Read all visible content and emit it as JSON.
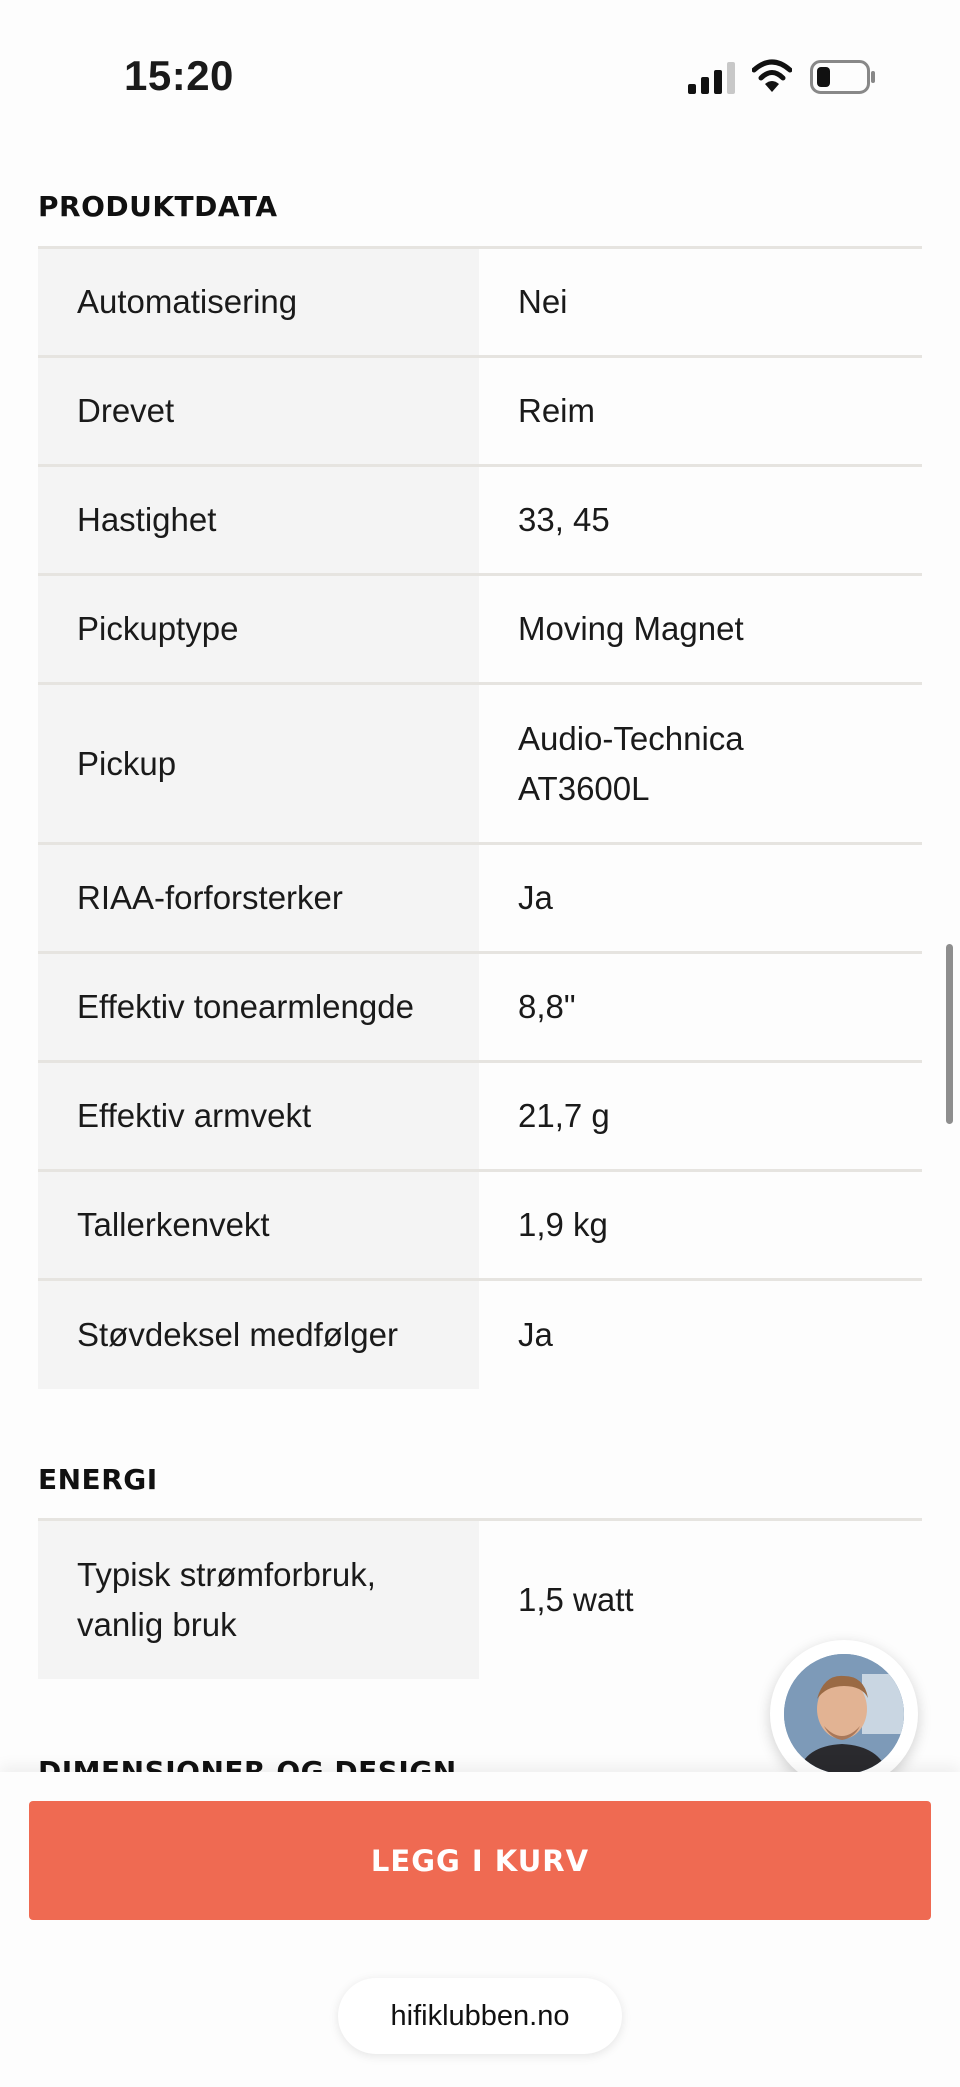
{
  "status_bar": {
    "time": "15:20"
  },
  "sections": {
    "produktdata": {
      "title": "PRODUKTDATA",
      "rows": [
        {
          "label": "Automatisering",
          "value": "Nei"
        },
        {
          "label": "Drevet",
          "value": "Reim"
        },
        {
          "label": "Hastighet",
          "value": "33, 45"
        },
        {
          "label": "Pickuptype",
          "value": "Moving Magnet"
        },
        {
          "label": "Pickup",
          "value": "Audio-Technica AT3600L"
        },
        {
          "label": "RIAA-forforsterker",
          "value": "Ja"
        },
        {
          "label": "Effektiv tonearmlengde",
          "value": "8,8\""
        },
        {
          "label": "Effektiv armvekt",
          "value": "21,7 g"
        },
        {
          "label": "Tallerkenvekt",
          "value": "1,9 kg"
        },
        {
          "label": "Støvdeksel medfølger",
          "value": "Ja"
        }
      ]
    },
    "energi": {
      "title": "ENERGI",
      "rows": [
        {
          "label": "Typisk strømforbruk, vanlig bruk",
          "value": "1,5 watt"
        }
      ]
    },
    "dimensjoner": {
      "title": "DIMENSJONER OG DESIGN"
    }
  },
  "cart": {
    "button_label": "LEGG I KURV"
  },
  "browser": {
    "url": "hifiklubben.no"
  },
  "colors": {
    "accent": "#ef6a52",
    "row_label_bg": "#f4f4f4",
    "divider": "#e6e4e0"
  }
}
